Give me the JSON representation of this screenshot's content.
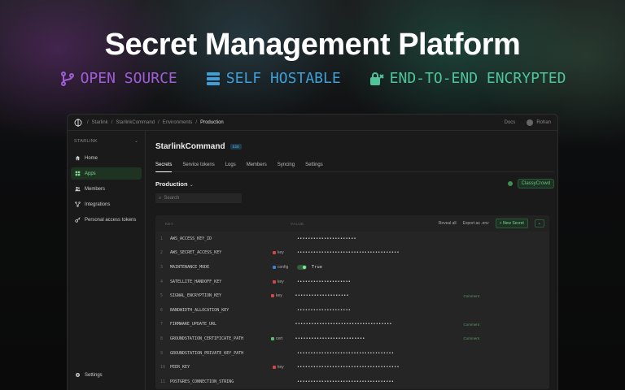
{
  "headline": "Secret Management Platform",
  "features": [
    {
      "label": "OPEN SOURCE",
      "icon": "git-branch-icon",
      "color": "#a05ed6"
    },
    {
      "label": "SELF HOSTABLE",
      "icon": "server-icon",
      "color": "#3e9fd8"
    },
    {
      "label": "END-TO-END ENCRYPTED",
      "icon": "lock-icon",
      "color": "#4fc49a"
    }
  ],
  "topbar": {
    "breadcrumbs": [
      "Starlink",
      "StarlinkCommand",
      "Environments",
      "Production"
    ],
    "docs": "Docs",
    "user": "Rohan"
  },
  "sidebar": {
    "org": "STARLINK",
    "items": [
      {
        "label": "Home",
        "icon": "home-icon",
        "active": false
      },
      {
        "label": "Apps",
        "icon": "apps-icon",
        "active": true
      },
      {
        "label": "Members",
        "icon": "users-icon",
        "active": false
      },
      {
        "label": "Integrations",
        "icon": "integrations-icon",
        "active": false
      },
      {
        "label": "Personal access tokens",
        "icon": "key-icon",
        "active": false
      }
    ],
    "settings": "Settings"
  },
  "app": {
    "title": "StarlinkCommand",
    "badge": "E2E",
    "tabs": [
      "Secrets",
      "Service tokens",
      "Logs",
      "Members",
      "Syncing",
      "Settings"
    ],
    "active_tab": "Secrets",
    "environment": "Production",
    "sync_label": "ClassyCrowd",
    "search_placeholder": "Search"
  },
  "table": {
    "headers": {
      "key": "KEY",
      "value": "VALUE"
    },
    "actions": {
      "reveal": "Reveal all",
      "export": "Export as .env",
      "new_secret": "+ New Secret"
    },
    "rows": [
      {
        "num": "1",
        "key": "AWS_ACCESS_KEY_ID",
        "tag": "",
        "tag_color": "",
        "value": "••••••••••••••••••••••",
        "comment": ""
      },
      {
        "num": "2",
        "key": "AWS_SECRET_ACCESS_KEY",
        "tag": "key",
        "tag_color": "#d64545",
        "value": "••••••••••••••••••••••••••••••••••••••",
        "comment": ""
      },
      {
        "num": "3",
        "key": "MAINTENANCE_MODE",
        "tag": "config",
        "tag_color": "#3e7fd6",
        "value": "True",
        "toggle": true,
        "comment": ""
      },
      {
        "num": "4",
        "key": "SATELLITE_HANDOFF_KEY",
        "tag": "key",
        "tag_color": "#d64545",
        "value": "••••••••••••••••••••",
        "comment": ""
      },
      {
        "num": "5",
        "key": "SIGNAL_ENCRYPTION_KEY",
        "tag": "key",
        "tag_color": "#d64545",
        "value": "••••••••••••••••••••",
        "comment": "Comment"
      },
      {
        "num": "6",
        "key": "BANDWIDTH_ALLOCATION_KEY",
        "tag": "",
        "tag_color": "",
        "value": "••••••••••••••••••••",
        "comment": ""
      },
      {
        "num": "7",
        "key": "FIRMWARE_UPDATE_URL",
        "tag": "",
        "tag_color": "",
        "value": "••••••••••••••••••••••••••••••••••••",
        "comment": "Comment"
      },
      {
        "num": "8",
        "key": "GROUNDSTATION_CERTIFICATE_PATH",
        "tag": "cert",
        "tag_color": "#4fc46a",
        "value": "••••••••••••••••••••••••••",
        "comment": "Comment"
      },
      {
        "num": "9",
        "key": "GROUNDSTATION_PRIVATE_KEY_PATH",
        "tag": "",
        "tag_color": "",
        "value": "••••••••••••••••••••••••••••••••••••",
        "comment": ""
      },
      {
        "num": "10",
        "key": "PEER_KEY",
        "tag": "key",
        "tag_color": "#d64545",
        "value": "••••••••••••••••••••••••••••••••••••••",
        "comment": ""
      },
      {
        "num": "11",
        "key": "POSTGRES_CONNECTION_STRING",
        "tag": "",
        "tag_color": "",
        "value": "••••••••••••••••••••••••••••••••••••",
        "comment": ""
      }
    ]
  }
}
